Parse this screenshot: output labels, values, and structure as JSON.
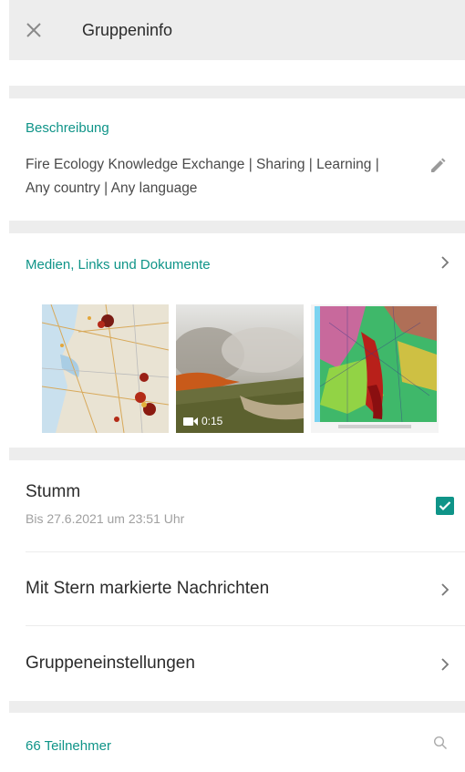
{
  "header": {
    "title": "Gruppeninfo",
    "close_icon": "close-icon"
  },
  "description": {
    "label": "Beschreibung",
    "text": "Fire Ecology Knowledge Exchange | Sharing | Learning | Any country | Any language",
    "edit_icon": "pencil-icon"
  },
  "media": {
    "label": "Medien, Links und Dokumente",
    "items": [
      {
        "type": "map-image",
        "icon": "map-thumbnail"
      },
      {
        "type": "video",
        "duration": "0:15",
        "icon": "video-camera-icon"
      },
      {
        "type": "weather-map-image",
        "icon": "radar-thumbnail"
      }
    ]
  },
  "mute": {
    "title": "Stumm",
    "subtitle": "Bis 27.6.2021 um 23:51 Uhr",
    "checked": true
  },
  "starred": {
    "title": "Mit Stern markierte Nachrichten"
  },
  "settings": {
    "title": "Gruppeneinstellungen"
  },
  "participants": {
    "label": "66 Teilnehmer",
    "search_icon": "search-icon"
  },
  "colors": {
    "accent": "#0f9488",
    "header_bg": "#ededed",
    "gap_bg": "#ededed"
  }
}
